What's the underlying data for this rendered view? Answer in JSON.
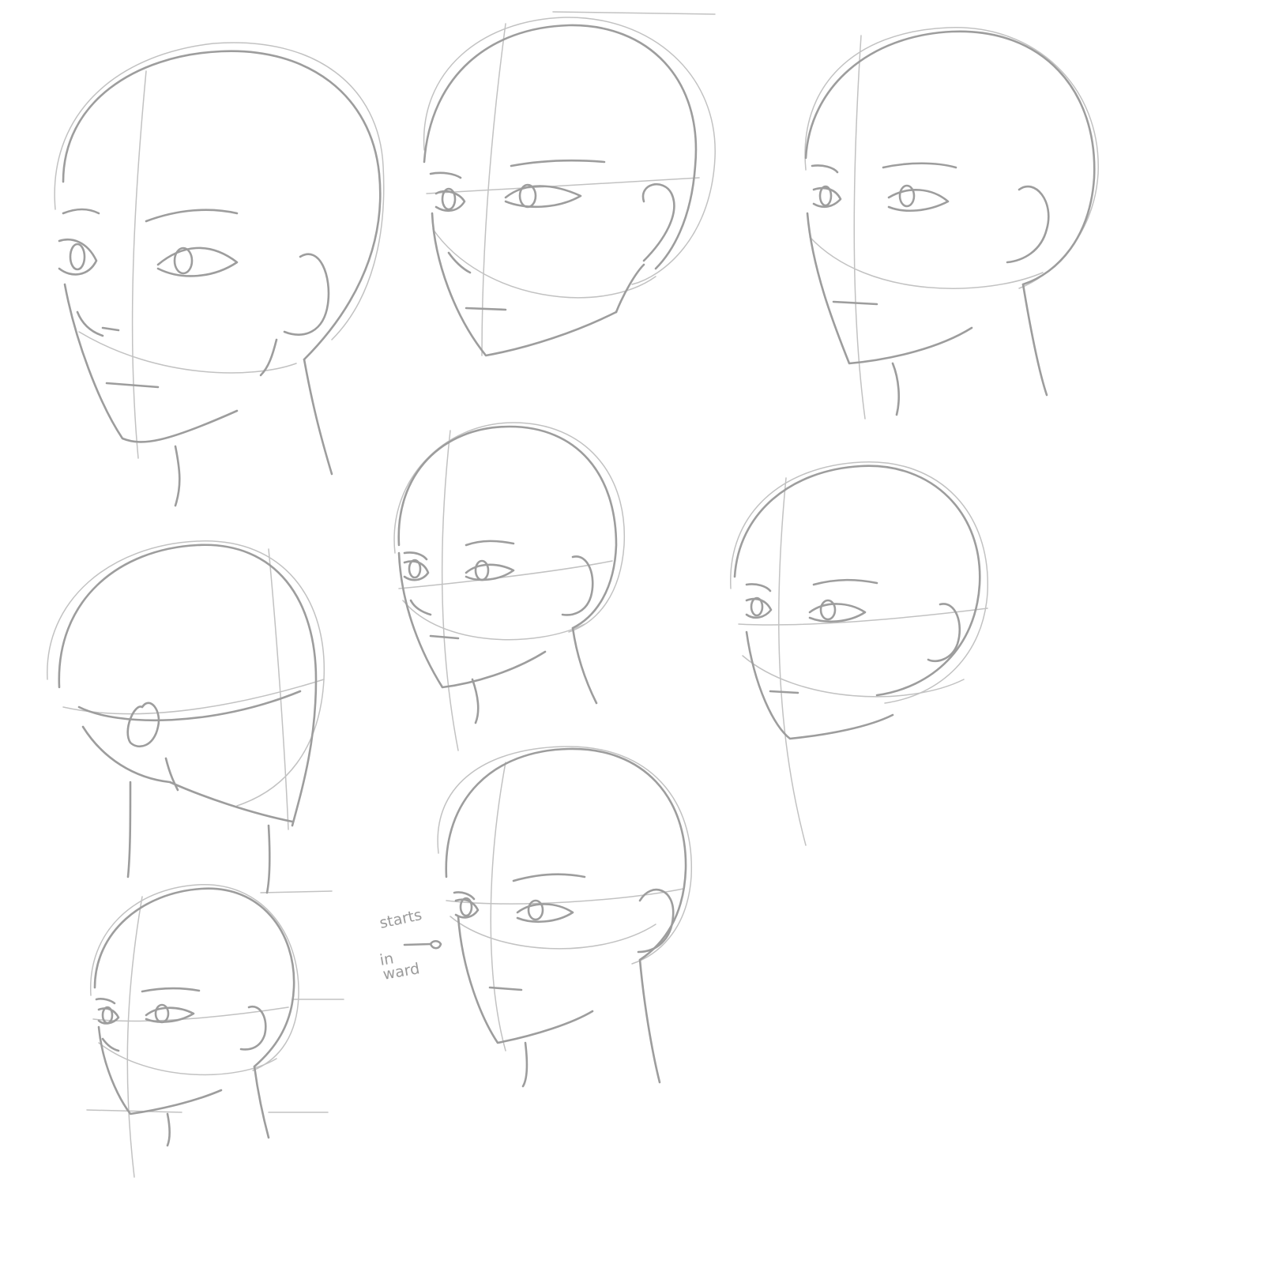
{
  "note": {
    "line1": "starts",
    "line2": "in",
    "line3": "ward"
  },
  "colors": {
    "background": "#ffffff",
    "construction": "#c2c2c2",
    "outline": "#9d9d9d"
  }
}
